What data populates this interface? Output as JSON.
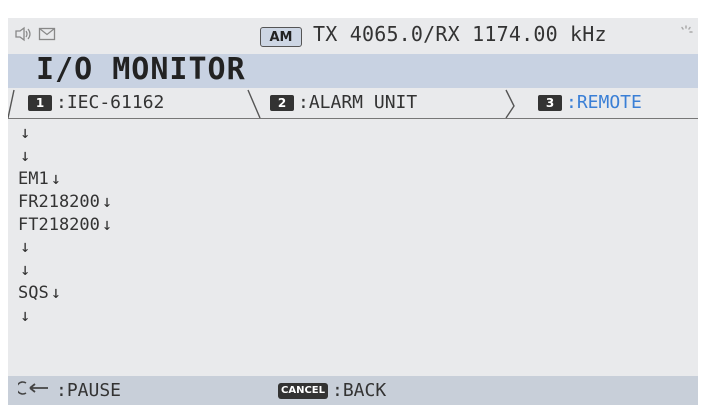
{
  "status_bar": {
    "speaker_icon": "speaker-icon",
    "mail_icon": "mail-icon",
    "mode_badge": "AM",
    "frequency_text": "TX 4065.0/RX 1174.00 kHz"
  },
  "title": "I/O MONITOR",
  "tabs": [
    {
      "number": "1",
      "label": ":IEC-61162",
      "active": false
    },
    {
      "number": "2",
      "label": ":ALARM UNIT",
      "active": false
    },
    {
      "number": "3",
      "label": ":REMOTE",
      "active": true
    }
  ],
  "monitor_lines": [
    "",
    "",
    "EM1",
    "FR218200",
    "FT218200",
    "",
    "",
    "SQS",
    ""
  ],
  "bottom_bar": {
    "enter_hint": ":PAUSE",
    "cancel_key": "CANCEL",
    "cancel_hint": ":BACK"
  },
  "colors": {
    "title_bg": "#c8d2e2",
    "active_tab": "#3a7fd6",
    "screen_bg": "#e9eaec"
  }
}
